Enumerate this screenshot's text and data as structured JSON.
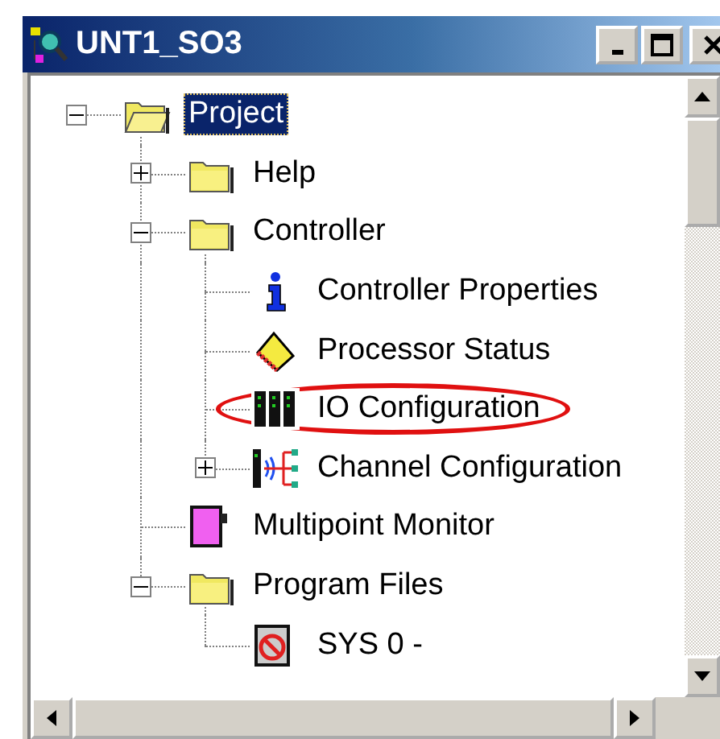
{
  "window": {
    "title": "UNT1_SO3"
  },
  "tree": [
    {
      "label": "Project",
      "kind": "folder-open",
      "selected": true,
      "circled": false,
      "expanded": true,
      "children": [
        {
          "label": "Help",
          "kind": "folder",
          "selected": false,
          "circled": false,
          "expanded": false
        },
        {
          "label": "Controller",
          "kind": "folder",
          "selected": false,
          "circled": false,
          "expanded": true,
          "children": [
            {
              "label": "Controller Properties",
              "kind": "info",
              "selected": false,
              "circled": false
            },
            {
              "label": "Processor Status",
              "kind": "chip",
              "selected": false,
              "circled": false
            },
            {
              "label": "IO Configuration",
              "kind": "io",
              "selected": false,
              "circled": true
            },
            {
              "label": "Channel Configuration",
              "kind": "channel",
              "selected": false,
              "circled": false,
              "expanded": false
            }
          ]
        },
        {
          "label": "Multipoint Monitor",
          "kind": "monitor",
          "selected": false,
          "circled": false
        },
        {
          "label": "Program Files",
          "kind": "folder",
          "selected": false,
          "circled": false,
          "expanded": true,
          "children": [
            {
              "label": "SYS 0 -",
              "kind": "program",
              "selected": false,
              "circled": false
            }
          ]
        }
      ]
    }
  ]
}
